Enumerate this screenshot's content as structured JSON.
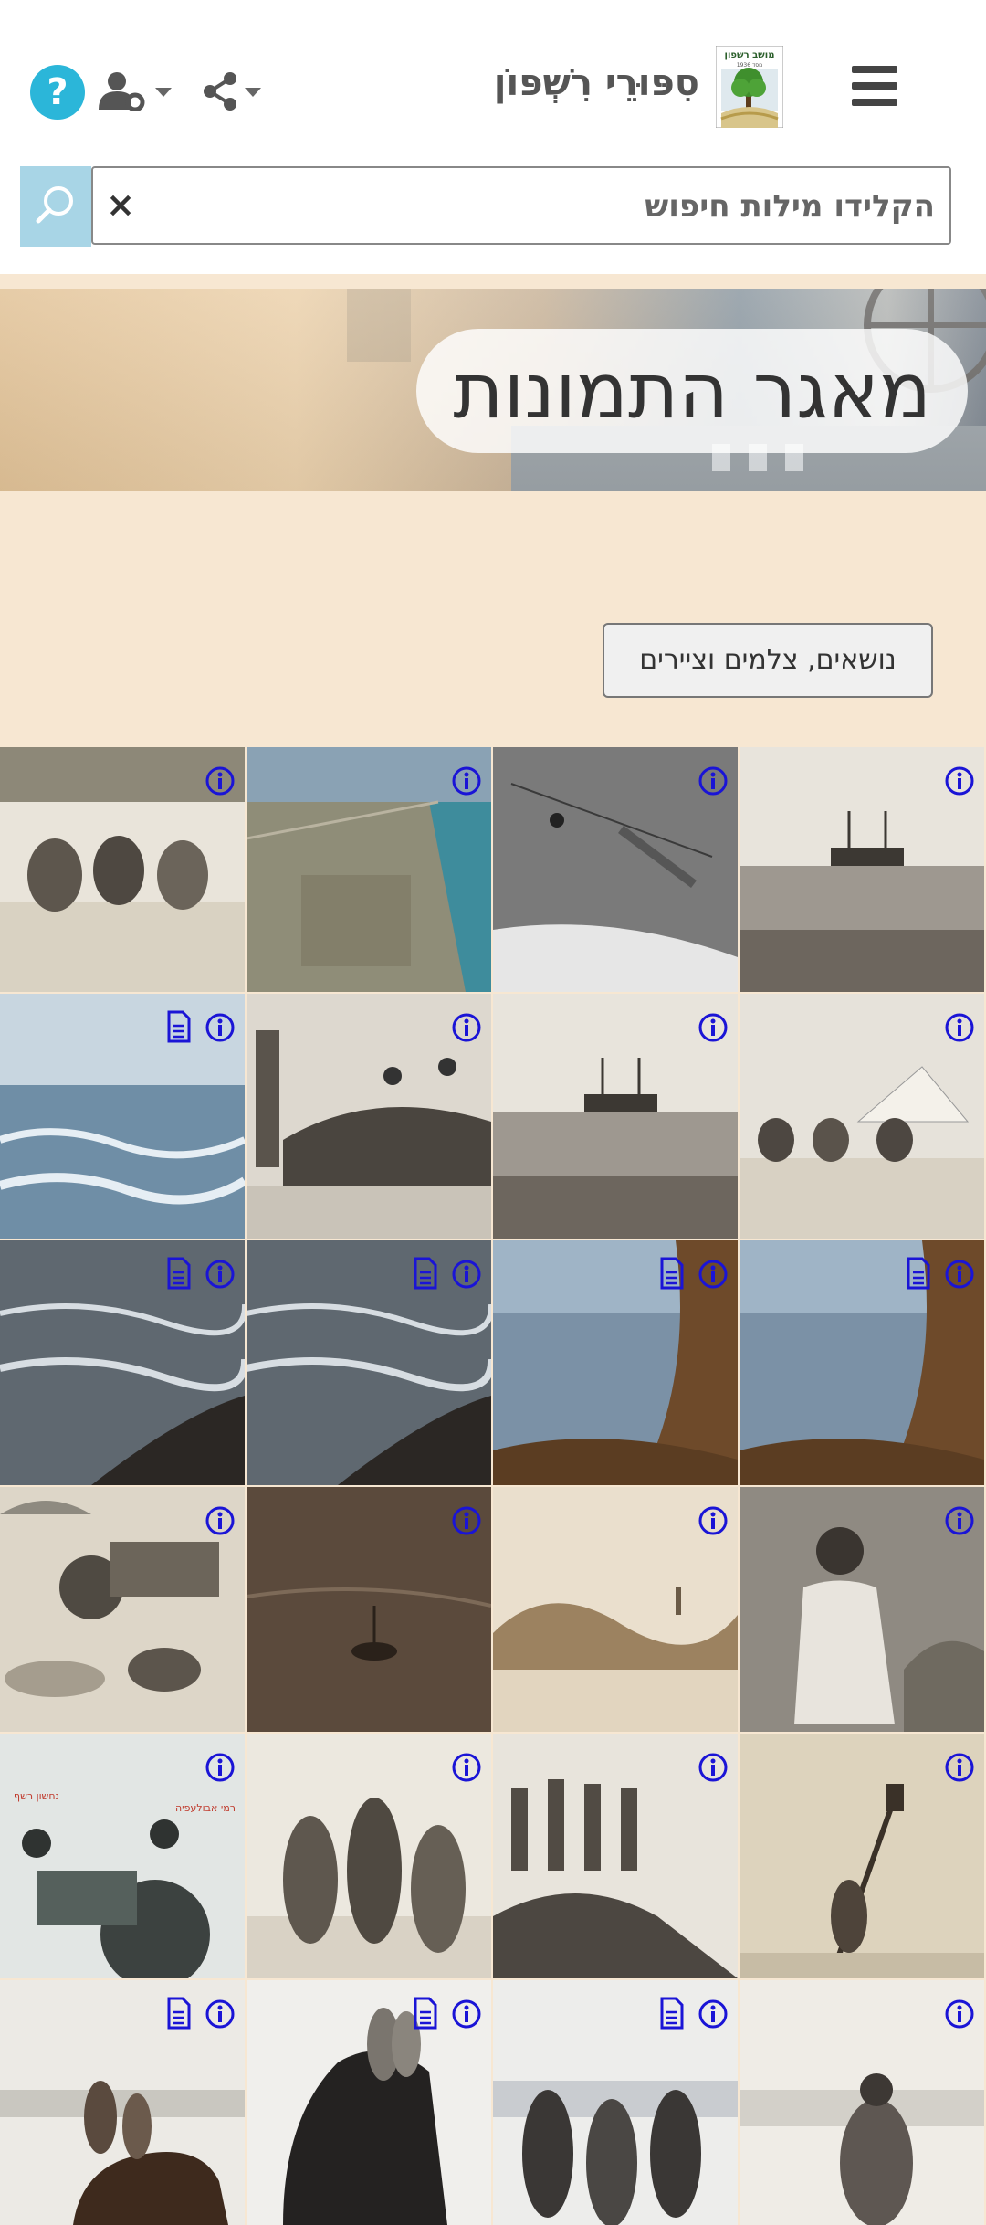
{
  "header": {
    "site_title": "סִפּוּרֵי רִשְׁפּוֹן",
    "logo_text": "מושב רשפון",
    "logo_subtext": "נוסד 1936",
    "help_label": "?",
    "icons": [
      "menu-icon",
      "share-icon",
      "user-settings-icon",
      "help-icon"
    ]
  },
  "search": {
    "placeholder": "הקלידו מילות חיפוש",
    "clear_label": "×",
    "icon": "search-icon"
  },
  "banner": {
    "title": "מאגר התמונות"
  },
  "filter": {
    "label": "נושאים, צלמים וציירים"
  },
  "colors": {
    "accent": "#2bb6d9",
    "search_button": "#a8d5e6",
    "page_background": "#f7e7d2",
    "overlay_icons": "#1a14d6"
  },
  "gallery": [
    {
      "scene": "beach-group",
      "doc": false
    },
    {
      "scene": "aerial-coast",
      "doc": false
    },
    {
      "scene": "map-sketch",
      "doc": false
    },
    {
      "scene": "shipwreck",
      "doc": false
    },
    {
      "scene": "sea-waves",
      "doc": true
    },
    {
      "scene": "rocks-people",
      "doc": false
    },
    {
      "scene": "shipwreck",
      "doc": false
    },
    {
      "scene": "beach-tent",
      "doc": false
    },
    {
      "scene": "swimmer-waves",
      "doc": true
    },
    {
      "scene": "swimmer-waves",
      "doc": true
    },
    {
      "scene": "cliff-sea",
      "doc": true
    },
    {
      "scene": "cliff-sea",
      "doc": true
    },
    {
      "scene": "tractor-beach",
      "doc": false
    },
    {
      "scene": "boat-dark-sea",
      "doc": false
    },
    {
      "scene": "beach-cliffs",
      "doc": false
    },
    {
      "scene": "man-portrait",
      "doc": false
    },
    {
      "scene": "tractor-caption",
      "doc": false,
      "caption_right": "רמי אבולעפיה",
      "caption_left": "נחשון רשף"
    },
    {
      "scene": "boys-group",
      "doc": false
    },
    {
      "scene": "people-rocks",
      "doc": false
    },
    {
      "scene": "man-paddle",
      "doc": false
    },
    {
      "scene": "horse-beach",
      "doc": true
    },
    {
      "scene": "horse-riders",
      "doc": true
    },
    {
      "scene": "men-beach",
      "doc": true
    },
    {
      "scene": "woman-beach",
      "doc": false
    }
  ]
}
